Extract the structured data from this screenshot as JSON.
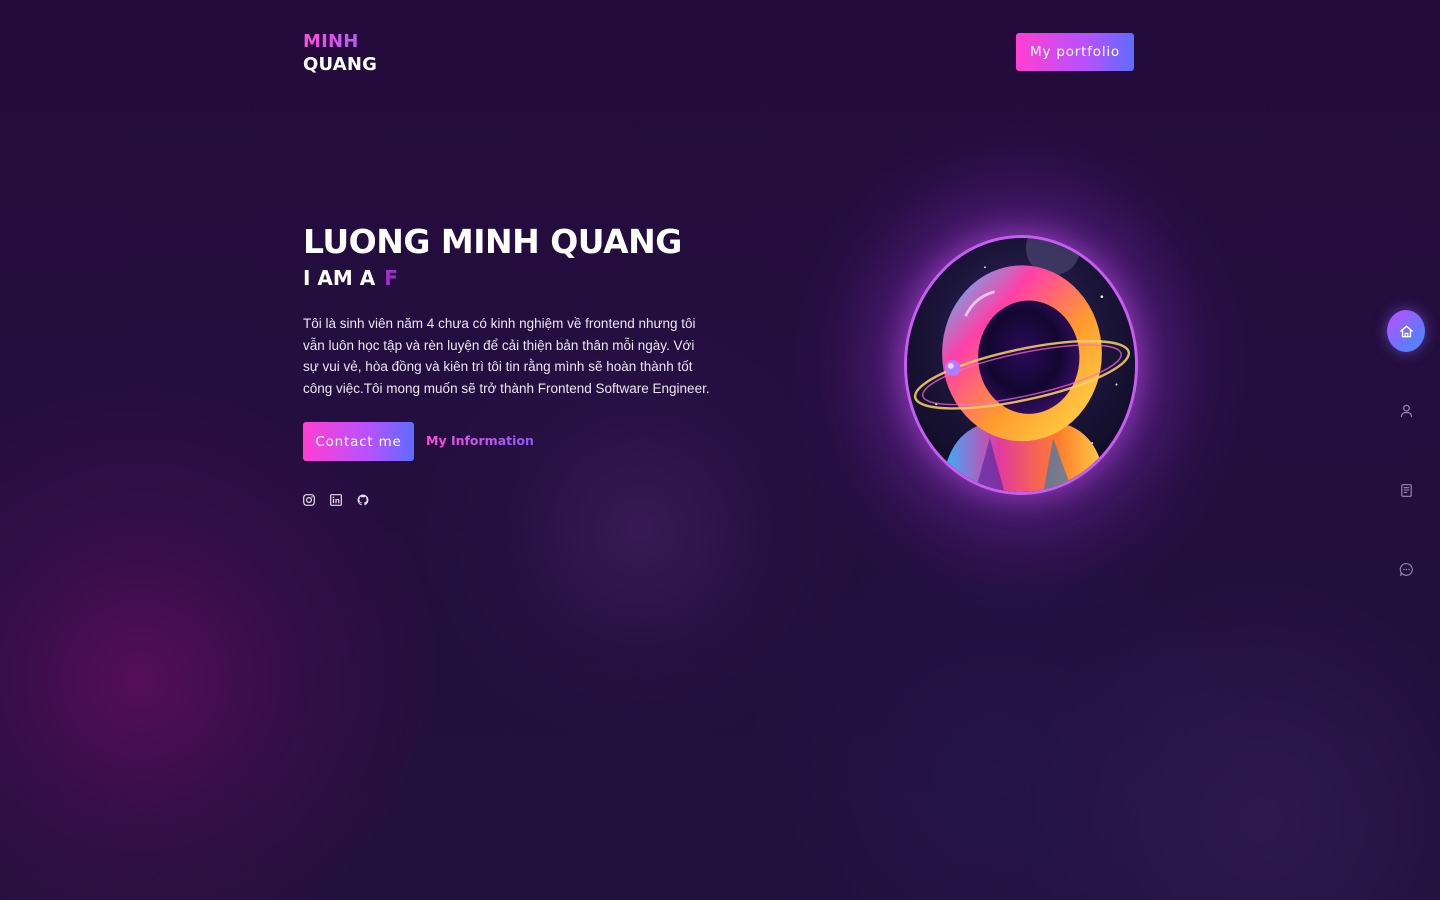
{
  "brand": {
    "line1": "MINH",
    "line2": "QUANG",
    "accent_gradient": [
      "#ff4fd8",
      "#a45cff"
    ]
  },
  "header": {
    "portfolio_label": "My portfolio"
  },
  "hero": {
    "name": "LUONG MINH QUANG",
    "role_prefix": "I AM A",
    "role_typed": "F",
    "description": "Tôi là sinh viên năm 4 chưa có kinh nghiệm về frontend nhưng tôi vẫn luôn học tập và rèn luyện để cải thiện bản thân mỗi ngày. Với sự vui vẻ, hòa đồng và kiên trì tôi tin rằng mình sẽ hoàn thành tốt công việc.Tôi mong muốn sẽ trở thành Frontend Software Engineer.",
    "contact_label": "Contact me",
    "info_label": "My Information"
  },
  "socials": [
    {
      "icon": "instagram-icon"
    },
    {
      "icon": "linkedin-icon"
    },
    {
      "icon": "github-icon"
    }
  ],
  "avatar": {
    "subject": "astronaut-illustration"
  },
  "sidenav": [
    {
      "icon": "home-icon",
      "active": true
    },
    {
      "icon": "user-icon",
      "active": false
    },
    {
      "icon": "document-icon",
      "active": false
    },
    {
      "icon": "chat-icon",
      "active": false
    }
  ],
  "colors": {
    "background": "#230c3b",
    "accent_pink": "#ff3fd1",
    "accent_purple": "#b552ff",
    "accent_blue": "#5d6cff",
    "typed_text": "#a32fd0",
    "avatar_ring": "#c65ef0"
  }
}
